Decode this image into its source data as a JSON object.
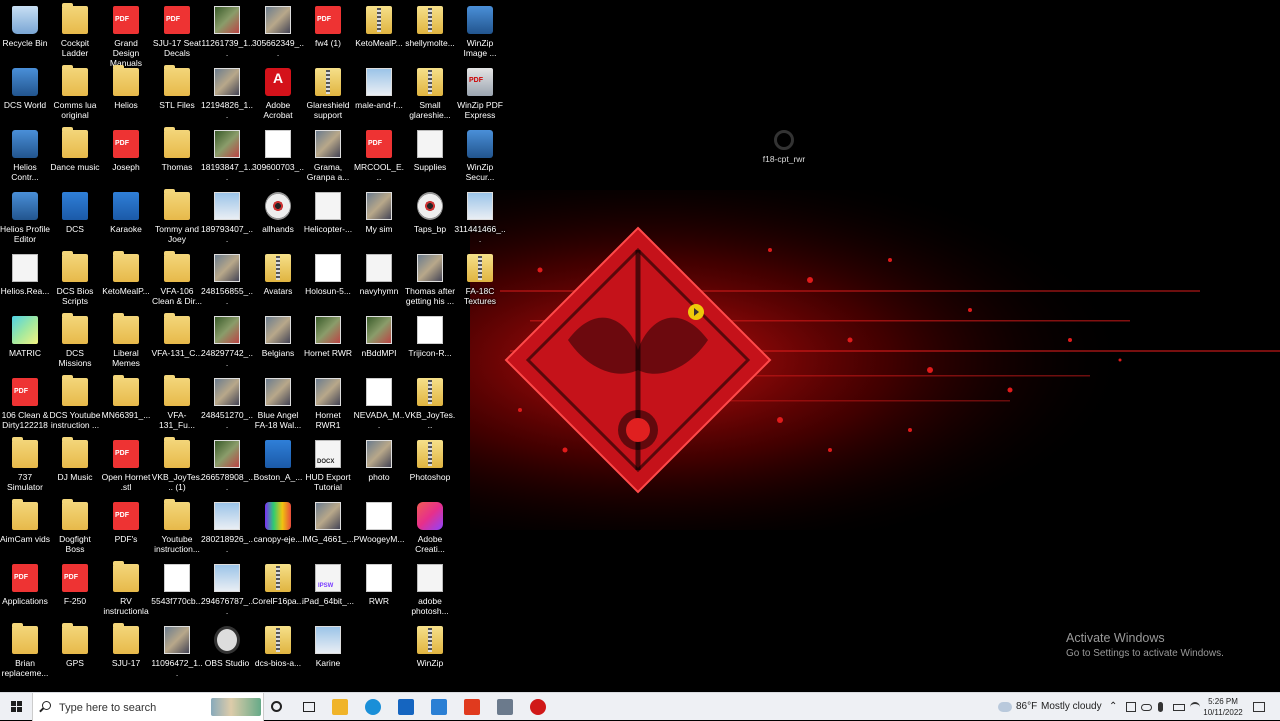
{
  "desktop": {
    "icons": [
      {
        "label": "Recycle Bin",
        "icon": "recycle-bin-icon",
        "style": "g-recycle"
      },
      {
        "label": "DCS World",
        "icon": "dcs-world-icon",
        "style": "g-app"
      },
      {
        "label": "Helios Contr...",
        "icon": "helios-control-icon",
        "style": "g-app"
      },
      {
        "label": "Helios Profile Editor",
        "icon": "helios-editor-icon",
        "style": "g-app"
      },
      {
        "label": "Helios.Rea...",
        "icon": "document-icon",
        "style": "g-doc"
      },
      {
        "label": "MATRIC",
        "icon": "matric-icon",
        "style": "g-matric"
      },
      {
        "label": "106 Clean & Dirty122218",
        "icon": "pdf-icon",
        "style": "g-pdf"
      },
      {
        "label": "737 Simulator",
        "icon": "folder-icon",
        "style": "g-folder"
      },
      {
        "label": "AimCam vids",
        "icon": "folder-icon",
        "style": "g-folder"
      },
      {
        "label": "Applications",
        "icon": "pdf-icon",
        "style": "g-pdf"
      },
      {
        "label": "Brian replaceme...",
        "icon": "folder-icon",
        "style": "g-folder"
      },
      {
        "label": "Cockpit Ladder",
        "icon": "folder-icon",
        "style": "g-folder"
      },
      {
        "label": "Comms lua original",
        "icon": "folder-icon",
        "style": "g-folder"
      },
      {
        "label": "Dance music",
        "icon": "folder-icon",
        "style": "g-folder"
      },
      {
        "label": "DCS",
        "icon": "folder-icon",
        "style": "g-blue"
      },
      {
        "label": "DCS Bios Scripts",
        "icon": "folder-icon",
        "style": "g-folder"
      },
      {
        "label": "DCS Missions",
        "icon": "folder-icon",
        "style": "g-folder"
      },
      {
        "label": "DCS Youtube instruction ...",
        "icon": "folder-icon",
        "style": "g-folder"
      },
      {
        "label": "DJ Music",
        "icon": "folder-icon",
        "style": "g-folder"
      },
      {
        "label": "Dogfight Boss",
        "icon": "folder-icon",
        "style": "g-folder"
      },
      {
        "label": "F-250",
        "icon": "pdf-icon",
        "style": "g-pdf"
      },
      {
        "label": "GPS",
        "icon": "folder-icon",
        "style": "g-folder"
      },
      {
        "label": "Grand Design Manuals",
        "icon": "pdf-icon",
        "style": "g-pdf"
      },
      {
        "label": "Helios",
        "icon": "folder-icon",
        "style": "g-folder"
      },
      {
        "label": "Joseph",
        "icon": "pdf-icon",
        "style": "g-pdf"
      },
      {
        "label": "Karaoke",
        "icon": "folder-icon",
        "style": "g-blue"
      },
      {
        "label": "KetoMealP...",
        "icon": "folder-icon",
        "style": "g-folder"
      },
      {
        "label": "Liberal Memes",
        "icon": "folder-icon",
        "style": "g-folder"
      },
      {
        "label": "MN66391_...",
        "icon": "folder-icon",
        "style": "g-folder"
      },
      {
        "label": "Open Hornet .stl",
        "icon": "pdf-icon",
        "style": "g-pdf"
      },
      {
        "label": "PDF's",
        "icon": "pdf-icon",
        "style": "g-pdf"
      },
      {
        "label": "RV instructionla",
        "icon": "folder-icon",
        "style": "g-folder"
      },
      {
        "label": "SJU-17",
        "icon": "folder-icon",
        "style": "g-folder"
      },
      {
        "label": "SJU-17 Seat Decals",
        "icon": "pdf-icon",
        "style": "g-pdf"
      },
      {
        "label": "STL Files",
        "icon": "folder-icon",
        "style": "g-folder"
      },
      {
        "label": "Thomas",
        "icon": "folder-icon",
        "style": "g-folder"
      },
      {
        "label": "Tommy and Joey",
        "icon": "folder-icon",
        "style": "g-folder"
      },
      {
        "label": "VFA-106 Clean & Dir...",
        "icon": "folder-icon",
        "style": "g-folder"
      },
      {
        "label": "VFA-131_C...",
        "icon": "folder-icon",
        "style": "g-folder"
      },
      {
        "label": "VFA-131_Fu...",
        "icon": "folder-icon",
        "style": "g-folder"
      },
      {
        "label": "VKB_JoyTes... (1)",
        "icon": "folder-icon",
        "style": "g-folder"
      },
      {
        "label": "Youtube instruction...",
        "icon": "folder-icon",
        "style": "g-folder"
      },
      {
        "label": "5543f770cb...",
        "icon": "image-icon",
        "style": "g-white"
      },
      {
        "label": "11096472_1...",
        "icon": "image-icon",
        "style": "g-img"
      },
      {
        "label": "11261739_1...",
        "icon": "image-icon",
        "style": "g-img2"
      },
      {
        "label": "12194826_1...",
        "icon": "image-icon",
        "style": "g-img"
      },
      {
        "label": "18193847_1...",
        "icon": "image-icon",
        "style": "g-img2"
      },
      {
        "label": "189793407_...",
        "icon": "image-icon",
        "style": "g-img3"
      },
      {
        "label": "248156855_...",
        "icon": "image-icon",
        "style": "g-img"
      },
      {
        "label": "248297742_...",
        "icon": "image-icon",
        "style": "g-img2"
      },
      {
        "label": "248451270_...",
        "icon": "image-icon",
        "style": "g-img"
      },
      {
        "label": "266578908_...",
        "icon": "image-icon",
        "style": "g-img2"
      },
      {
        "label": "280218926_...",
        "icon": "image-icon",
        "style": "g-img3"
      },
      {
        "label": "294676787_...",
        "icon": "image-icon",
        "style": "g-img3"
      },
      {
        "label": "OBS Studio",
        "icon": "obs-studio-icon",
        "style": "g-obs"
      },
      {
        "label": "305662349_...",
        "icon": "image-icon",
        "style": "g-img"
      },
      {
        "label": "Adobe Acrobat",
        "icon": "adobe-acrobat-icon",
        "style": "g-adobe"
      },
      {
        "label": "309600703_...",
        "icon": "image-icon",
        "style": "g-white"
      },
      {
        "label": "allhands",
        "icon": "media-icon",
        "style": "g-disc"
      },
      {
        "label": "Avatars",
        "icon": "zip-folder-icon",
        "style": "g-zip"
      },
      {
        "label": "Belgians",
        "icon": "image-icon",
        "style": "g-img"
      },
      {
        "label": "Blue Angel FA-18 Wal...",
        "icon": "image-icon",
        "style": "g-img"
      },
      {
        "label": "Boston_A_...",
        "icon": "image-icon",
        "style": "g-blue"
      },
      {
        "label": "canopy-eje...",
        "icon": "canopy-app-icon",
        "style": "g-canopy"
      },
      {
        "label": "CorelF16pa...",
        "icon": "zip-folder-icon",
        "style": "g-zip"
      },
      {
        "label": "dcs-bios-a...",
        "icon": "zip-folder-icon",
        "style": "g-zip"
      },
      {
        "label": "fw4 (1)",
        "icon": "pdf-icon",
        "style": "g-pdf"
      },
      {
        "label": "Glareshield support",
        "icon": "zip-folder-icon",
        "style": "g-zip"
      },
      {
        "label": "Grama, Granpa a...",
        "icon": "image-icon",
        "style": "g-img"
      },
      {
        "label": "Helicopter-...",
        "icon": "document-icon",
        "style": "g-doc"
      },
      {
        "label": "Holosun-5...",
        "icon": "image-icon",
        "style": "g-white"
      },
      {
        "label": "Hornet RWR",
        "icon": "image-icon",
        "style": "g-img2"
      },
      {
        "label": "Hornet RWR1",
        "icon": "image-icon",
        "style": "g-img"
      },
      {
        "label": "HUD Export Tutorial",
        "icon": "word-doc-icon",
        "style": "g-hud"
      },
      {
        "label": "IMG_4661_...",
        "icon": "image-icon",
        "style": "g-img"
      },
      {
        "label": "iPad_64bit_...",
        "icon": "ipsw-file-icon",
        "style": "g-ipsw"
      },
      {
        "label": "Karine",
        "icon": "image-icon",
        "style": "g-img3"
      },
      {
        "label": "KetoMealP...",
        "icon": "zip-folder-icon",
        "style": "g-zip"
      },
      {
        "label": "male-and-f...",
        "icon": "image-icon",
        "style": "g-img3"
      },
      {
        "label": "MRCOOL_E...",
        "icon": "pdf-icon",
        "style": "g-pdf"
      },
      {
        "label": "My sim",
        "icon": "image-icon",
        "style": "g-img"
      },
      {
        "label": "navyhymn",
        "icon": "document-icon",
        "style": "g-doc"
      },
      {
        "label": "nBddMPI",
        "icon": "image-icon",
        "style": "g-img2"
      },
      {
        "label": "NEVADA_M...",
        "icon": "document-icon",
        "style": "g-white"
      },
      {
        "label": "photo",
        "icon": "image-icon",
        "style": "g-img"
      },
      {
        "label": "PWoogeyM...",
        "icon": "image-icon",
        "style": "g-white"
      },
      {
        "label": "RWR",
        "icon": "image-icon",
        "style": "g-white"
      },
      {
        "label": "shellymolte...",
        "icon": "zip-folder-icon",
        "style": "g-zip"
      },
      {
        "label": "Small glareshie...",
        "icon": "zip-folder-icon",
        "style": "g-zip"
      },
      {
        "label": "Supplies",
        "icon": "document-icon",
        "style": "g-doc"
      },
      {
        "label": "Taps_bp",
        "icon": "media-icon",
        "style": "g-disc"
      },
      {
        "label": "Thomas after getting his ...",
        "icon": "image-icon",
        "style": "g-img"
      },
      {
        "label": "Trijicon-R...",
        "icon": "image-icon",
        "style": "g-white"
      },
      {
        "label": "VKB_JoyTes...",
        "icon": "zip-folder-icon",
        "style": "g-zip"
      },
      {
        "label": "Photoshop",
        "icon": "zip-folder-icon",
        "style": "g-zip"
      },
      {
        "label": "Adobe Creati...",
        "icon": "creative-cloud-icon",
        "style": "g-cc"
      },
      {
        "label": "adobe photosh...",
        "icon": "document-icon",
        "style": "g-doc"
      },
      {
        "label": "WinZip",
        "icon": "zip-folder-icon",
        "style": "g-zip"
      },
      {
        "label": "WinZip Image ...",
        "icon": "winzip-icon",
        "style": "g-app"
      },
      {
        "label": "WinZip PDF Express",
        "icon": "winzip-pdf-icon",
        "style": "g-winzip"
      },
      {
        "label": "WinZip Secur...",
        "icon": "winzip-secure-icon",
        "style": "g-app"
      },
      {
        "label": "311441466_...",
        "icon": "image-icon",
        "style": "g-img3"
      },
      {
        "label": "FA-18C Textures",
        "icon": "zip-folder-icon",
        "style": "g-zip"
      }
    ],
    "floating_icon": {
      "label": "f18-cpt_rwr",
      "icon": "settings-file-icon"
    },
    "watermark": {
      "title": "Activate Windows",
      "subtitle": "Go to Settings to activate Windows."
    }
  },
  "taskbar": {
    "search_placeholder": "Type here to search",
    "pinned": [
      {
        "name": "cortana-icon"
      },
      {
        "name": "task-view-icon"
      },
      {
        "name": "file-explorer-icon",
        "color": "#f0b429"
      },
      {
        "name": "edge-icon",
        "color": "#1a8fd8"
      },
      {
        "name": "store-icon",
        "color": "#1565c0"
      },
      {
        "name": "mail-icon",
        "color": "#2a7fd4"
      },
      {
        "name": "office-icon",
        "color": "#e03a1e"
      },
      {
        "name": "dcs-app-icon",
        "color": "#6b7a8c"
      },
      {
        "name": "screen-recorder-icon",
        "color": "#d01818"
      }
    ],
    "weather": {
      "temp": "86°F",
      "condition": "Mostly cloudy"
    },
    "clock": {
      "time": "5:26 PM",
      "date": "10/11/2022"
    }
  }
}
